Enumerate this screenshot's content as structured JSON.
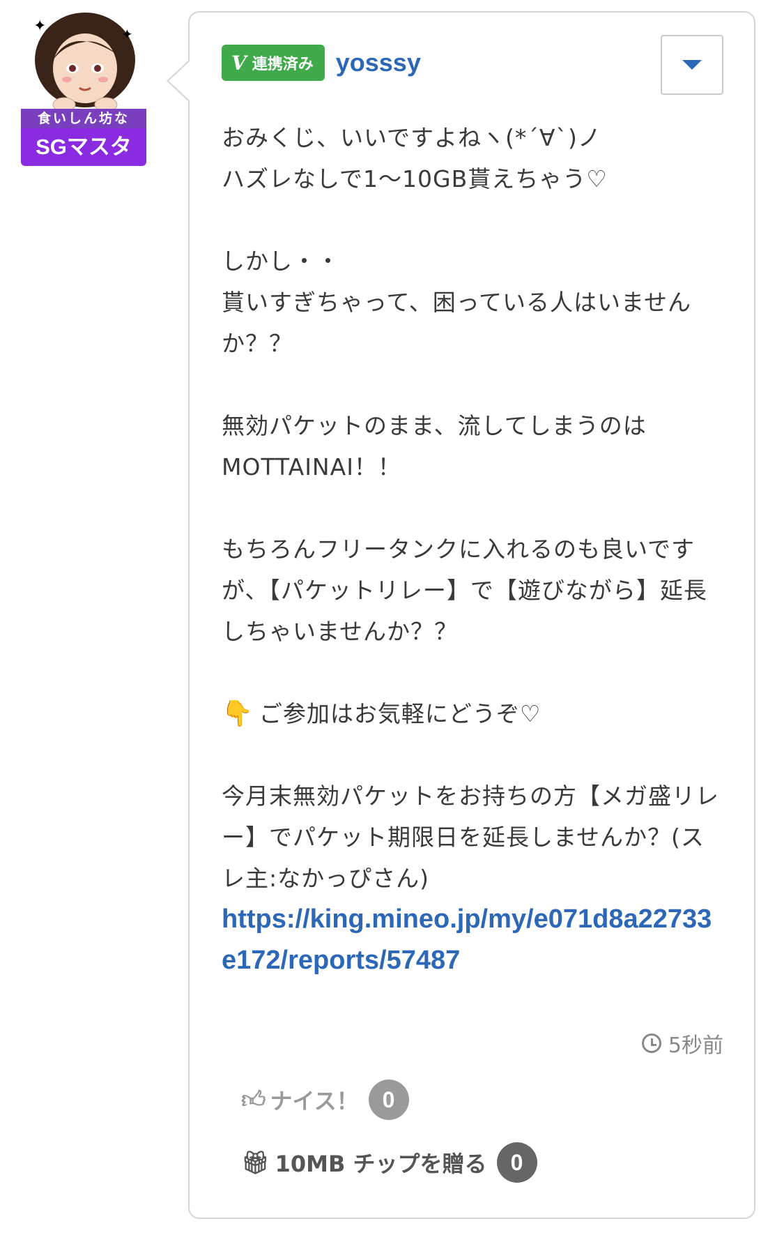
{
  "author": {
    "avatar_banner": "食いしん坊な",
    "rank": "SGマスタ",
    "linked_badge": "連携済み",
    "linked_icon": "v-check-icon",
    "username": "yosssy"
  },
  "post": {
    "lines": {
      "p1a": "おみくじ、いいですよねヽ(*´∀`)ノ",
      "p1b": "ハズレなしで1〜10GB貰えちゃう♡",
      "p2a": "しかし・・",
      "p2b": "貰いすぎちゃって、困っている人はいませんか？？",
      "p3a": "無効パケットのまま、流してしまうのは",
      "p3b": "MOTTAINAI！！",
      "p4": "もちろんフリータンクに入れるのも良いですが、【パケットリレー】で【遊びながら】延長しちゃいませんか？？",
      "p5": "ご参加はお気軽にどうぞ♡",
      "p6": "今月末無効パケットをお持ちの方【メガ盛リレー】でパケット期限日を延長しませんか？(スレ主:なかっぴさん)"
    },
    "link": "https://king.mineo.jp/my/e071d8a22733e172/reports/57487",
    "pointer_emoji": "👇"
  },
  "meta": {
    "timestamp": "5秒前"
  },
  "actions": {
    "nice_label": "ナイス！",
    "nice_count": "0",
    "tip_label": "10MB チップを贈る",
    "tip_count": "0"
  },
  "colors": {
    "accent_blue": "#2d67b8",
    "linked_green": "#3faa4a",
    "rank_purple": "#8a2be2"
  }
}
